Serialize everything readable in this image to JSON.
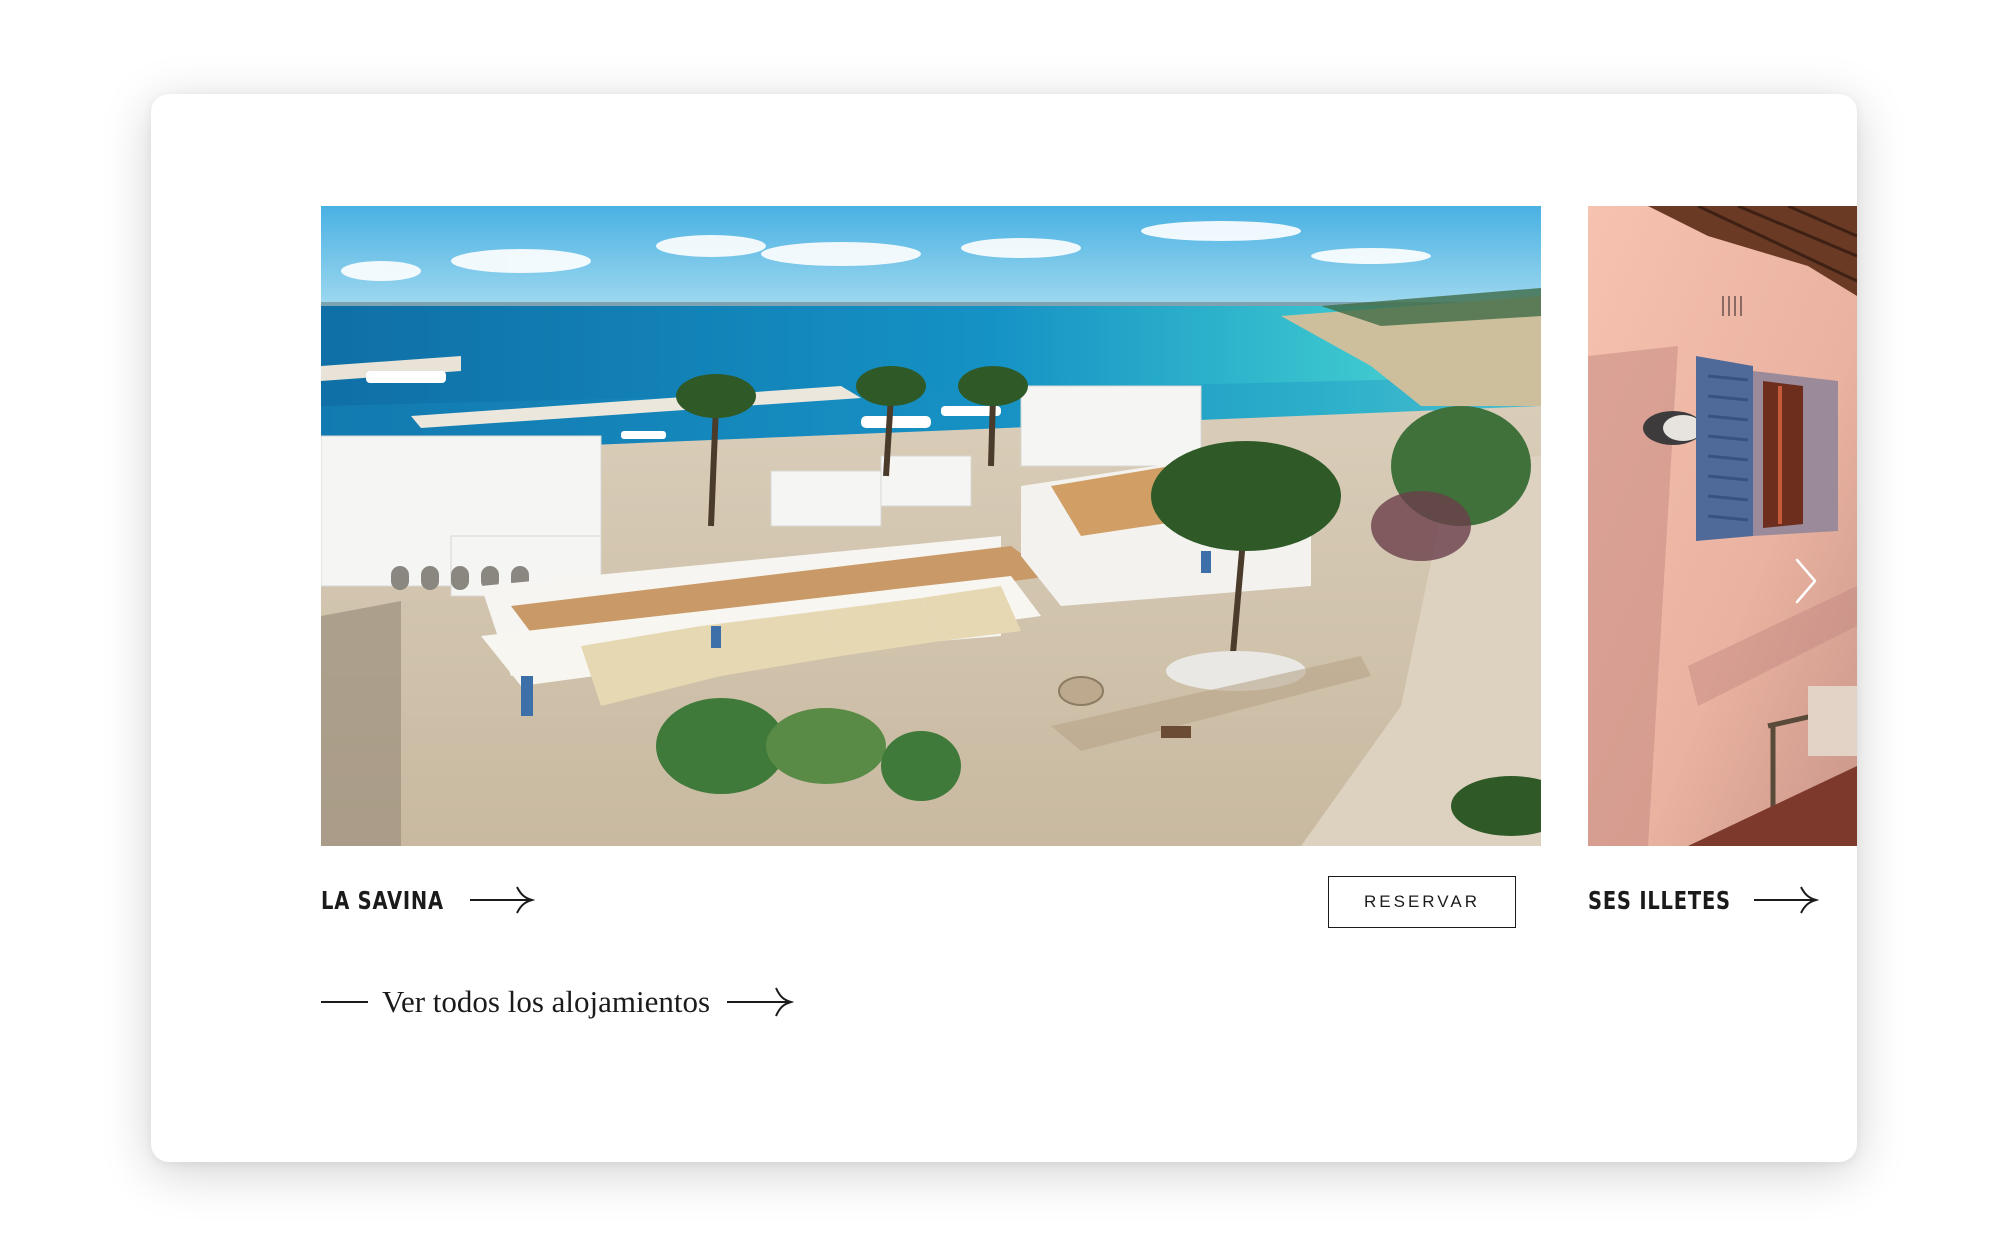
{
  "carousel": {
    "slides": [
      {
        "name": "LA SAVINA",
        "image_alt": "La Savina",
        "reserve_label": "RESERVAR"
      },
      {
        "name": "SES ILLETES",
        "image_alt": "Ses Illetes"
      }
    ],
    "next_icon": "chevron-right-icon"
  },
  "footer_link": {
    "label": "Ver todos los alojamientos"
  },
  "colors": {
    "text": "#1b1b1b",
    "background": "#ffffff",
    "sea": "#1d8fbf",
    "sky": "#5cbde6"
  }
}
